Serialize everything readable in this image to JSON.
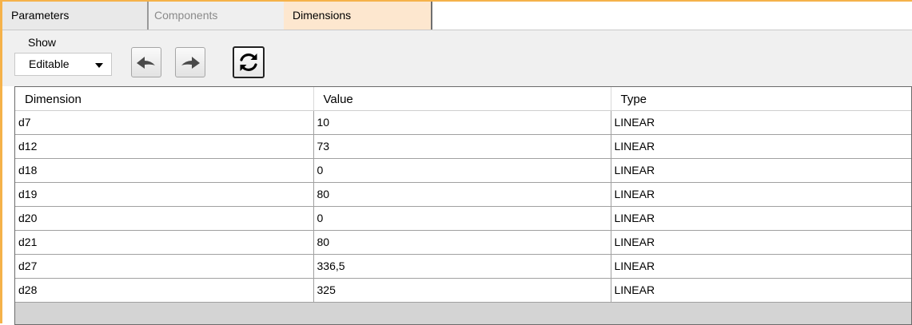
{
  "tabs": [
    {
      "label": "Parameters"
    },
    {
      "label": "Components"
    },
    {
      "label": "Dimensions"
    }
  ],
  "toolbar": {
    "show_label": "Show",
    "show_value": "Editable"
  },
  "grid": {
    "columns": [
      "Dimension",
      "Value",
      "Type"
    ],
    "rows": [
      [
        "d7",
        "10",
        "LINEAR"
      ],
      [
        "d12",
        "73",
        "LINEAR"
      ],
      [
        "d18",
        "0",
        "LINEAR"
      ],
      [
        "d19",
        "80",
        "LINEAR"
      ],
      [
        "d20",
        "0",
        "LINEAR"
      ],
      [
        "d21",
        "80",
        "LINEAR"
      ],
      [
        "d27",
        "336,5",
        "LINEAR"
      ],
      [
        "d28",
        "325",
        "LINEAR"
      ]
    ]
  },
  "colors": {
    "accent_border": "#f5b24a",
    "active_tab": "#fde7cf"
  }
}
